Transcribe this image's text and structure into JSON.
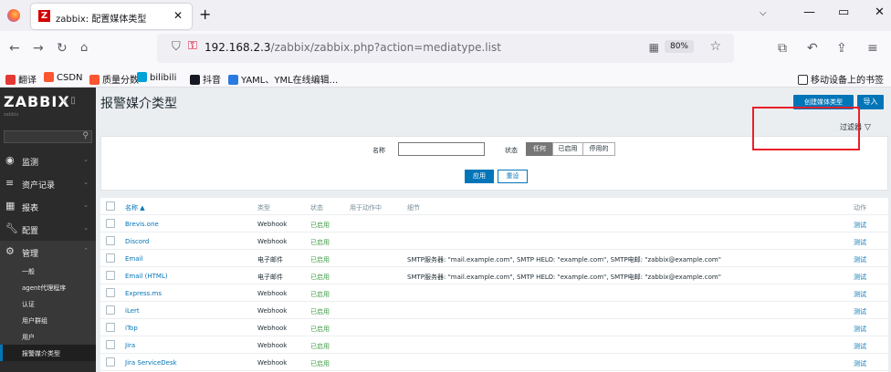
{
  "browser": {
    "tab_title": "zabbix: 配置媒体类型",
    "tab_logo": "Z",
    "url_host": "192.168.2.3",
    "url_path": "/zabbix/zabbix.php?action=mediatype.list",
    "zoom": "80%",
    "bookmarks": [
      {
        "label": "翻译",
        "color": "#e53935"
      },
      {
        "label": "CSDN",
        "color": "#fc5531"
      },
      {
        "label": "质量分数",
        "color": "#fc5531"
      },
      {
        "label": "bilibili",
        "color": "#00a1d6"
      },
      {
        "label": "抖音",
        "color": "#161823"
      },
      {
        "label": "YAML、YML在线编辑...",
        "color": "#2a7ae2"
      }
    ],
    "mobile_bookmarks": "移动设备上的书签"
  },
  "sidebar": {
    "logo": "ZABBIX",
    "subtitle": "zabbix",
    "items": [
      {
        "label": "监测",
        "icon": "eye-icon"
      },
      {
        "label": "资产记录",
        "icon": "list-icon"
      },
      {
        "label": "报表",
        "icon": "chart-icon"
      },
      {
        "label": "配置",
        "icon": "wrench-icon"
      },
      {
        "label": "管理",
        "icon": "gear-icon"
      }
    ],
    "subitems": [
      "一般",
      "agent代理程序",
      "认证",
      "用户群组",
      "用户",
      "报警媒介类型"
    ]
  },
  "page": {
    "title": "报警媒介类型",
    "create_label": "创建媒体类型",
    "import_label": "导入",
    "filter_tab": "过滤器"
  },
  "filter": {
    "name_label": "名称",
    "status_label": "状态",
    "status_options": [
      "任何",
      "已启用",
      "停用的"
    ],
    "selected_status": "任何",
    "apply_label": "应用",
    "reset_label": "重设"
  },
  "table": {
    "headers": [
      "名称 ▲",
      "类型",
      "状态",
      "用于动作中",
      "细节",
      "动作"
    ],
    "rows": [
      {
        "name": "Brevis.one",
        "type": "Webhook",
        "status": "已启用",
        "details": "",
        "action": "测试"
      },
      {
        "name": "Discord",
        "type": "Webhook",
        "status": "已启用",
        "details": "",
        "action": "测试"
      },
      {
        "name": "Email",
        "type": "电子邮件",
        "status": "已启用",
        "details": "SMTP服务器: \"mail.example.com\", SMTP HELO: \"example.com\", SMTP电邮: \"zabbix@example.com\"",
        "action": "测试"
      },
      {
        "name": "Email (HTML)",
        "type": "电子邮件",
        "status": "已启用",
        "details": "SMTP服务器: \"mail.example.com\", SMTP HELO: \"example.com\", SMTP电邮: \"zabbix@example.com\"",
        "action": "测试"
      },
      {
        "name": "Express.ms",
        "type": "Webhook",
        "status": "已启用",
        "details": "",
        "action": "测试"
      },
      {
        "name": "iLert",
        "type": "Webhook",
        "status": "已启用",
        "details": "",
        "action": "测试"
      },
      {
        "name": "iTop",
        "type": "Webhook",
        "status": "已启用",
        "details": "",
        "action": "测试"
      },
      {
        "name": "Jira",
        "type": "Webhook",
        "status": "已启用",
        "details": "",
        "action": "测试"
      },
      {
        "name": "Jira ServiceDesk",
        "type": "Webhook",
        "status": "已启用",
        "details": "",
        "action": "测试"
      }
    ]
  },
  "colors": {
    "accent": "#0275b8",
    "enabled": "#429e47",
    "highlight": "#e8202a",
    "sidebar": "#2b2b2b"
  }
}
